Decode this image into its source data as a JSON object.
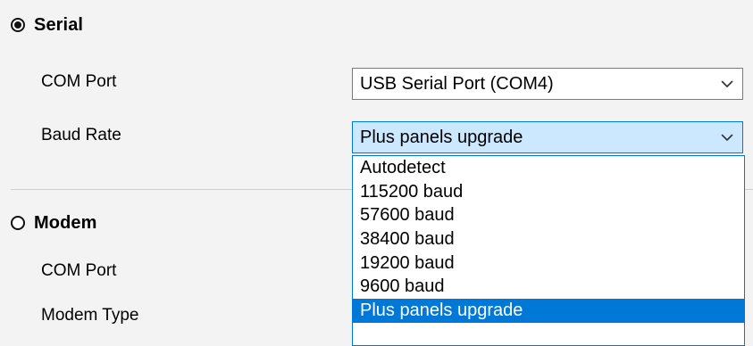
{
  "serial": {
    "label": "Serial",
    "selected": true,
    "com_port": {
      "label": "COM Port",
      "value": "USB Serial Port (COM4)"
    },
    "baud_rate": {
      "label": "Baud Rate",
      "value": "Plus panels upgrade",
      "options": [
        "Autodetect",
        "115200 baud",
        "57600 baud",
        "38400 baud",
        "19200 baud",
        "9600 baud",
        "Plus panels upgrade"
      ],
      "selected_index": 6
    }
  },
  "modem": {
    "label": "Modem",
    "selected": false,
    "com_port": {
      "label": "COM Port"
    },
    "modem_type": {
      "label": "Modem Type"
    }
  },
  "colors": {
    "accent": "#0078d7",
    "open_combo_bg": "#cce8ff",
    "page_bg": "#f3f3f3"
  },
  "icons": {
    "combo_chevron": "chevron-down-icon"
  }
}
